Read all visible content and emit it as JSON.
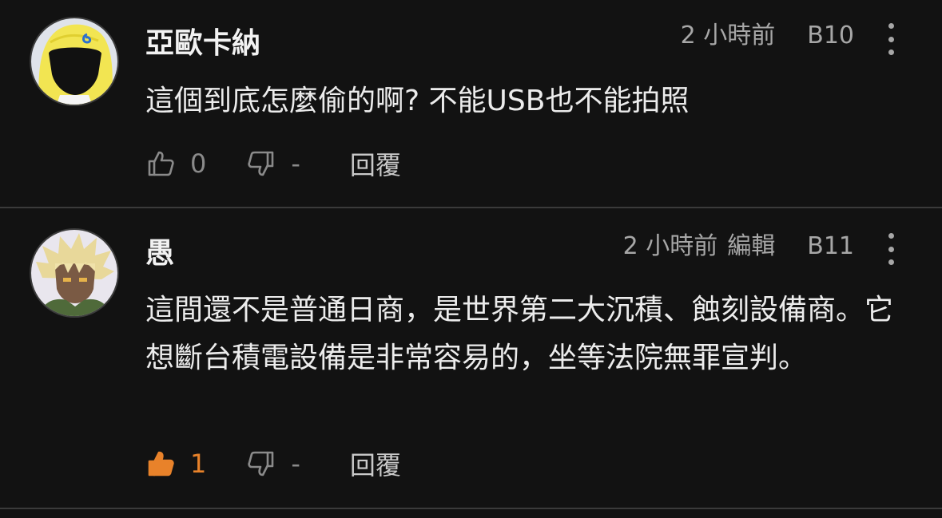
{
  "comments": [
    {
      "author": "亞歐卡納",
      "time": "2 小時前",
      "edited": "",
      "floor": "B10",
      "text": "這個到底怎麼偷的啊? 不能USB也不能拍照",
      "likes": "0",
      "dislikes": "-",
      "liked": false,
      "reply_label": "回覆",
      "avatar": "masked-figure-avatar"
    },
    {
      "author": "愚",
      "time": "2 小時前",
      "edited": "編輯",
      "floor": "B11",
      "text": "這間還不是普通日商，是世界第二大沉積、蝕刻設備商。它想斷台積電設備是非常容易的，坐等法院無罪宣判。",
      "likes": "1",
      "dislikes": "-",
      "liked": true,
      "reply_label": "回覆",
      "avatar": "anime-character-avatar"
    }
  ],
  "colors": {
    "background": "#121212",
    "text": "#ececec",
    "meta": "#a7a7a7",
    "liked": "#e8822a",
    "divider": "#3a3a3a"
  }
}
